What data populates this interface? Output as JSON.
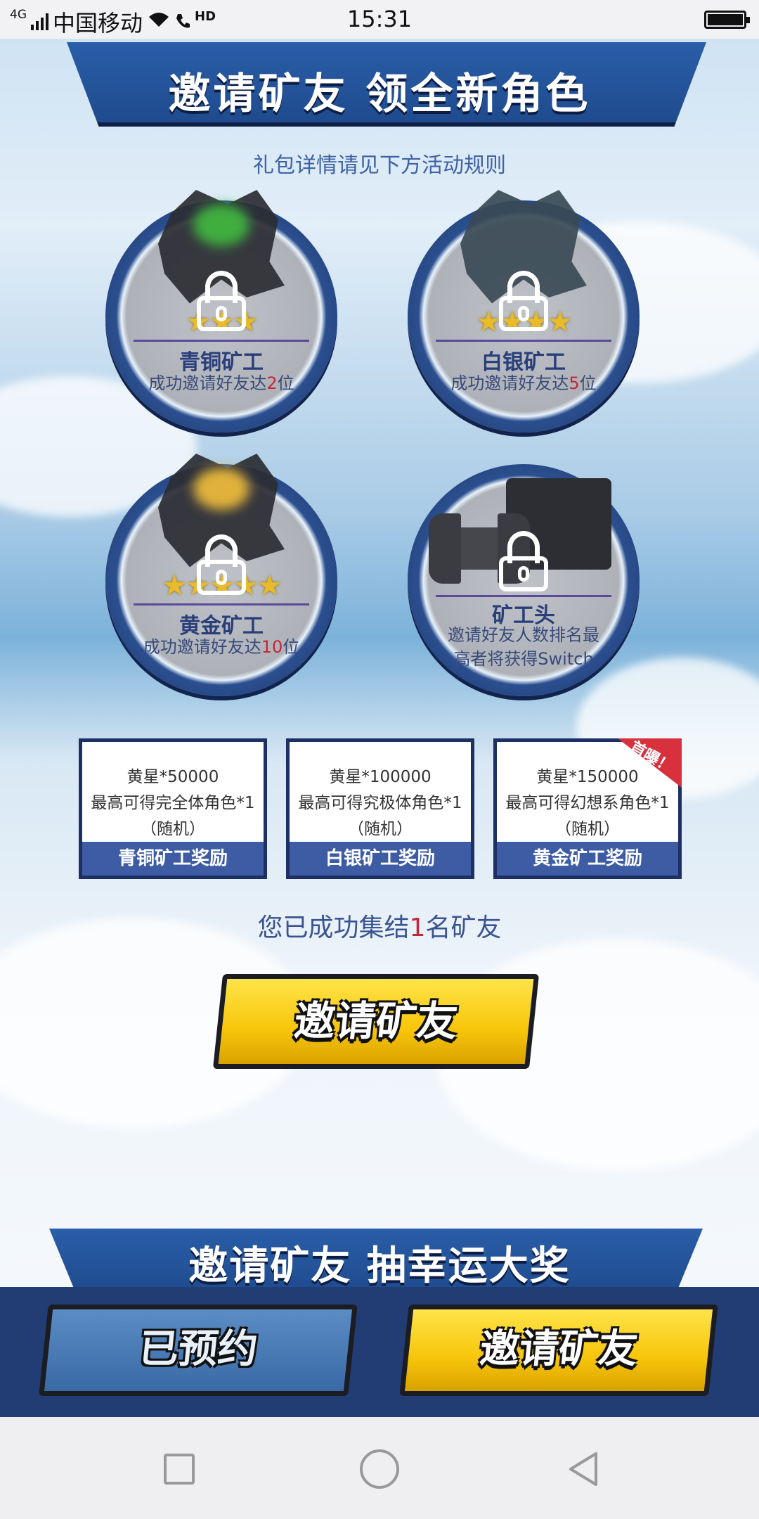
{
  "status_bar": {
    "network": "4G",
    "carrier": "中国移动",
    "hd": "HD",
    "time": "15:31"
  },
  "header": {
    "title": "邀请矿友 领全新角色",
    "subtitle": "礼包详情请见下方活动规则"
  },
  "tiers": [
    {
      "name": "青铜矿工",
      "desc_prefix": "成功邀请好友达",
      "count": "2",
      "desc_suffix": "位",
      "stars": "★★★"
    },
    {
      "name": "白银矿工",
      "desc_prefix": "成功邀请好友达",
      "count": "5",
      "desc_suffix": "位",
      "stars": "★★★★"
    },
    {
      "name": "黄金矿工",
      "desc_prefix": "成功邀请好友达",
      "count": "10",
      "desc_suffix": "位",
      "stars": "★★★★★"
    },
    {
      "name": "矿工头",
      "desc_line1": "邀请好友人数排名最",
      "desc_line2": "高者将获得Switch"
    }
  ],
  "reward_cards": [
    {
      "line1": "黄星*50000",
      "line2": "最高可得完全体角色*1",
      "line3": "（随机）",
      "footer": "青铜矿工奖励"
    },
    {
      "line1": "黄星*100000",
      "line2": "最高可得究极体角色*1",
      "line3": "（随机）",
      "footer": "白银矿工奖励"
    },
    {
      "line1": "黄星*150000",
      "line2": "最高可得幻想系角色*1",
      "line3": "（随机）",
      "footer": "黄金矿工奖励",
      "ribbon": "首曝！"
    }
  ],
  "gathered": {
    "prefix": "您已成功集结",
    "count": "1",
    "suffix": "名矿友"
  },
  "invite_button_label": "邀请矿友",
  "section2_title": "邀请矿友 抽幸运大奖",
  "bottom_bar": {
    "reserved_label": "已预约",
    "invite_label": "邀请矿友"
  },
  "colors": {
    "banner_blue": "#1f4b8e",
    "button_yellow": "#f7c50a",
    "highlight_red": "#c4263a"
  }
}
